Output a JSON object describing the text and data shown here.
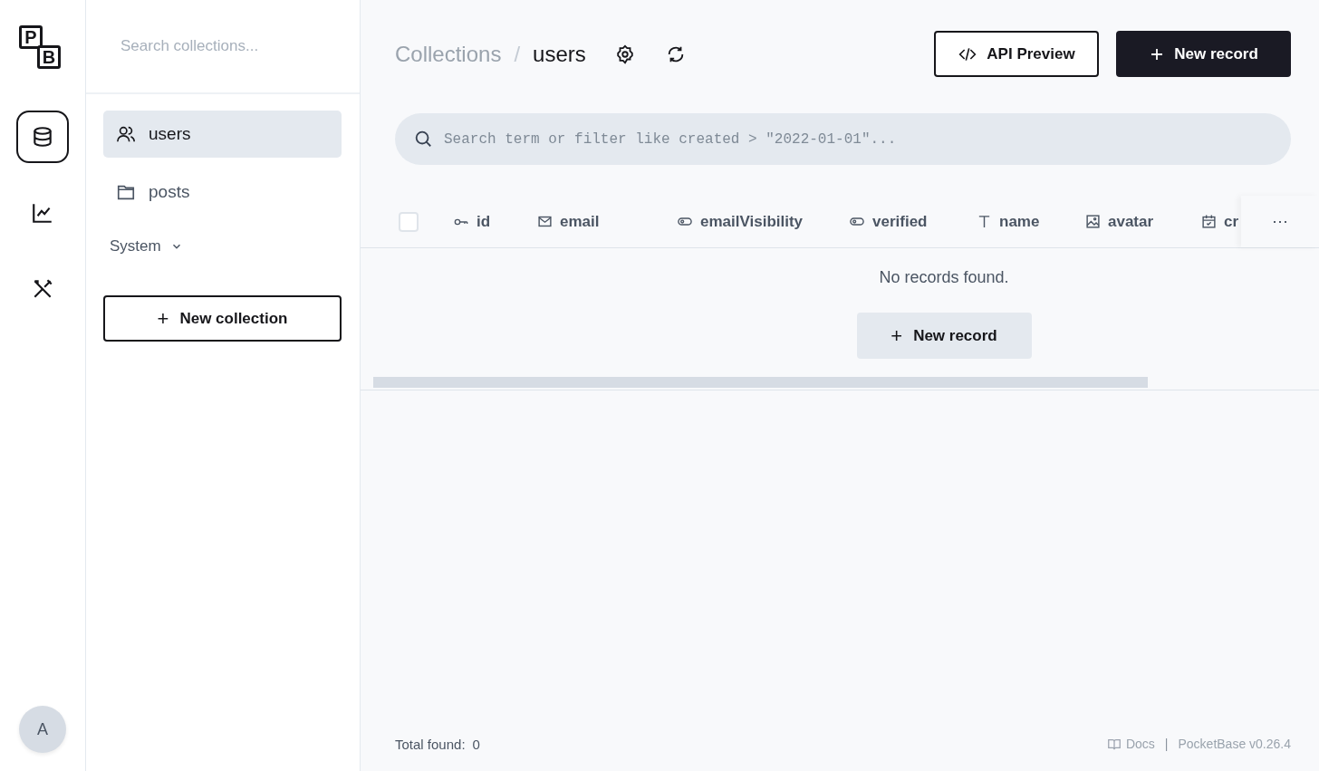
{
  "nav": [
    {
      "kind": "database",
      "selected": true
    },
    {
      "kind": "chart",
      "selected": false
    },
    {
      "kind": "tools",
      "selected": false
    }
  ],
  "logo": {
    "letters": [
      "P",
      "B"
    ]
  },
  "avatar": {
    "initial": "A"
  },
  "sidebar": {
    "search": {
      "placeholder": "Search collections..."
    },
    "collections": [
      {
        "name": "users",
        "kind": "auth",
        "selected": true
      },
      {
        "name": "posts",
        "kind": "base",
        "selected": false
      }
    ],
    "system_group": {
      "label": "System",
      "expanded": false
    },
    "new_button": {
      "icon": "+",
      "label": "New collection"
    }
  },
  "breadcrumb": {
    "parent": "Collections",
    "separator": "/",
    "current": "users"
  },
  "header_buttons": [
    {
      "kind": "outline",
      "label": "API Preview"
    },
    {
      "kind": "dark",
      "label": "New record"
    }
  ],
  "filter": {
    "placeholder": "Search term or filter like created > \"2022-01-01\"..."
  },
  "table": {
    "select_all": {
      "checked": false
    },
    "columns": [
      {
        "label": "id",
        "kind": "key"
      },
      {
        "label": "email",
        "kind": "email"
      },
      {
        "label": "emailVisibility",
        "kind": "bool"
      },
      {
        "label": "verified",
        "kind": "bool"
      },
      {
        "label": "name",
        "kind": "text"
      },
      {
        "label": "avatar",
        "kind": "image"
      },
      {
        "label": "cr",
        "kind": "date"
      }
    ],
    "menu": "···",
    "empty_message": "No records found.",
    "empty_button": {
      "icon": "+",
      "label": "New record"
    }
  },
  "footer": {
    "total_label": "Total found:",
    "total": "0",
    "docs": "Docs",
    "separator": "|",
    "version": "PocketBase v0.26.4"
  }
}
